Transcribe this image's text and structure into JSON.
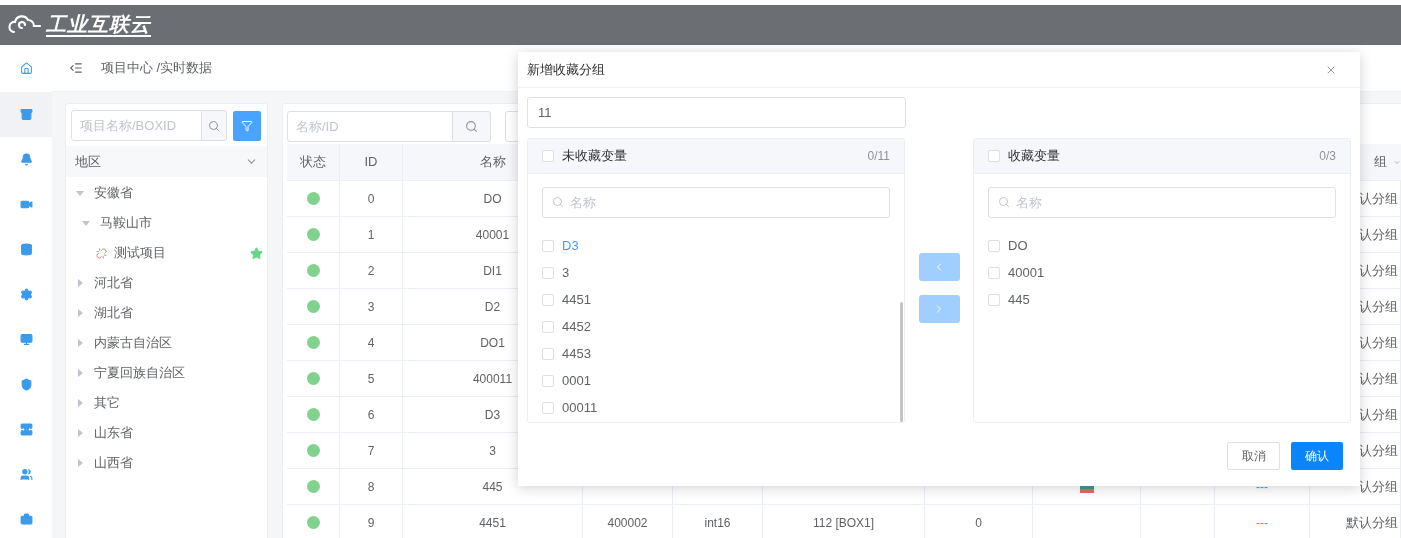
{
  "header": {
    "logo_text": "工业互联云"
  },
  "sidebar": {
    "items": [
      {
        "selected": false
      },
      {
        "selected": true
      },
      {
        "selected": false
      },
      {
        "selected": false
      },
      {
        "selected": false
      },
      {
        "selected": false
      },
      {
        "selected": false
      },
      {
        "selected": false
      },
      {
        "selected": false
      },
      {
        "selected": false
      },
      {
        "selected": false
      }
    ]
  },
  "breadcrumb": "项目中心 /实时数据",
  "tree_panel": {
    "search": {
      "placeholder": "项目名称/BOXID"
    },
    "filter_label": "地区",
    "items": [
      {
        "label": "安徽省",
        "kind": "region",
        "expanded": true,
        "children": [
          {
            "label": "马鞍山市",
            "kind": "region",
            "expanded": true,
            "children": [
              {
                "label": "测试项目",
                "kind": "project",
                "favorite": true
              }
            ]
          }
        ]
      },
      {
        "label": "河北省",
        "kind": "region",
        "expanded": false
      },
      {
        "label": "湖北省",
        "kind": "region",
        "expanded": false
      },
      {
        "label": "内蒙古自治区",
        "kind": "region",
        "expanded": false
      },
      {
        "label": "宁夏回族自治区",
        "kind": "region",
        "expanded": false
      },
      {
        "label": "其它",
        "kind": "region",
        "expanded": false
      },
      {
        "label": "山东省",
        "kind": "region",
        "expanded": false
      },
      {
        "label": "山西省",
        "kind": "region",
        "expanded": false
      }
    ]
  },
  "table_panel": {
    "search": {
      "placeholder": "名称/ID"
    },
    "columns": [
      "状态",
      "ID",
      "名称"
    ],
    "group_column": "组",
    "rows": [
      {
        "online": true,
        "id": "0",
        "name": "DO",
        "group": "认分组"
      },
      {
        "online": true,
        "id": "1",
        "name": "40001",
        "group": "认分组"
      },
      {
        "online": true,
        "id": "2",
        "name": "DI1",
        "group": "认分组"
      },
      {
        "online": true,
        "id": "3",
        "name": "D2",
        "group": "认分组"
      },
      {
        "online": true,
        "id": "4",
        "name": "DO1",
        "group": "认分组"
      },
      {
        "online": true,
        "id": "5",
        "name": "400011",
        "group": "认分组"
      },
      {
        "online": true,
        "id": "6",
        "name": "D3",
        "group": "认分组"
      },
      {
        "online": true,
        "id": "7",
        "name": "3",
        "group": "认分组"
      },
      {
        "online": true,
        "id": "8",
        "name": "445",
        "chart": true,
        "column_10": "---",
        "group": "认分组"
      },
      {
        "online": true,
        "id": "9",
        "name": "4451",
        "column_4": "400002",
        "column_5": "int16",
        "column_6": "112 [BOX1]",
        "column_7": "0",
        "column_10": "---",
        "group": "默认分组"
      }
    ]
  },
  "dialog": {
    "title": "新增收藏分组",
    "name_value": "11",
    "left": {
      "title": "未收藏变量",
      "count": "0/11",
      "checked": false,
      "search_placeholder": "名称",
      "items": [
        {
          "label": "D3",
          "checked": false,
          "hovered": true
        },
        {
          "label": "3",
          "checked": false,
          "hovered": false
        },
        {
          "label": "4451",
          "checked": false,
          "hovered": false
        },
        {
          "label": "4452",
          "checked": false,
          "hovered": false
        },
        {
          "label": "4453",
          "checked": false,
          "hovered": false
        },
        {
          "label": "0001",
          "checked": false,
          "hovered": false
        },
        {
          "label": "00011",
          "checked": false,
          "hovered": false
        }
      ]
    },
    "right": {
      "title": "收藏变量",
      "count": "0/3",
      "checked": false,
      "search_placeholder": "名称",
      "items": [
        {
          "label": "DO",
          "checked": false,
          "hovered": false
        },
        {
          "label": "40001",
          "checked": false,
          "hovered": false
        },
        {
          "label": "445",
          "checked": false,
          "hovered": false
        }
      ]
    },
    "move_left": {
      "disabled": true
    },
    "move_right": {
      "disabled": true
    },
    "cancel": "取消",
    "confirm": "确认"
  }
}
